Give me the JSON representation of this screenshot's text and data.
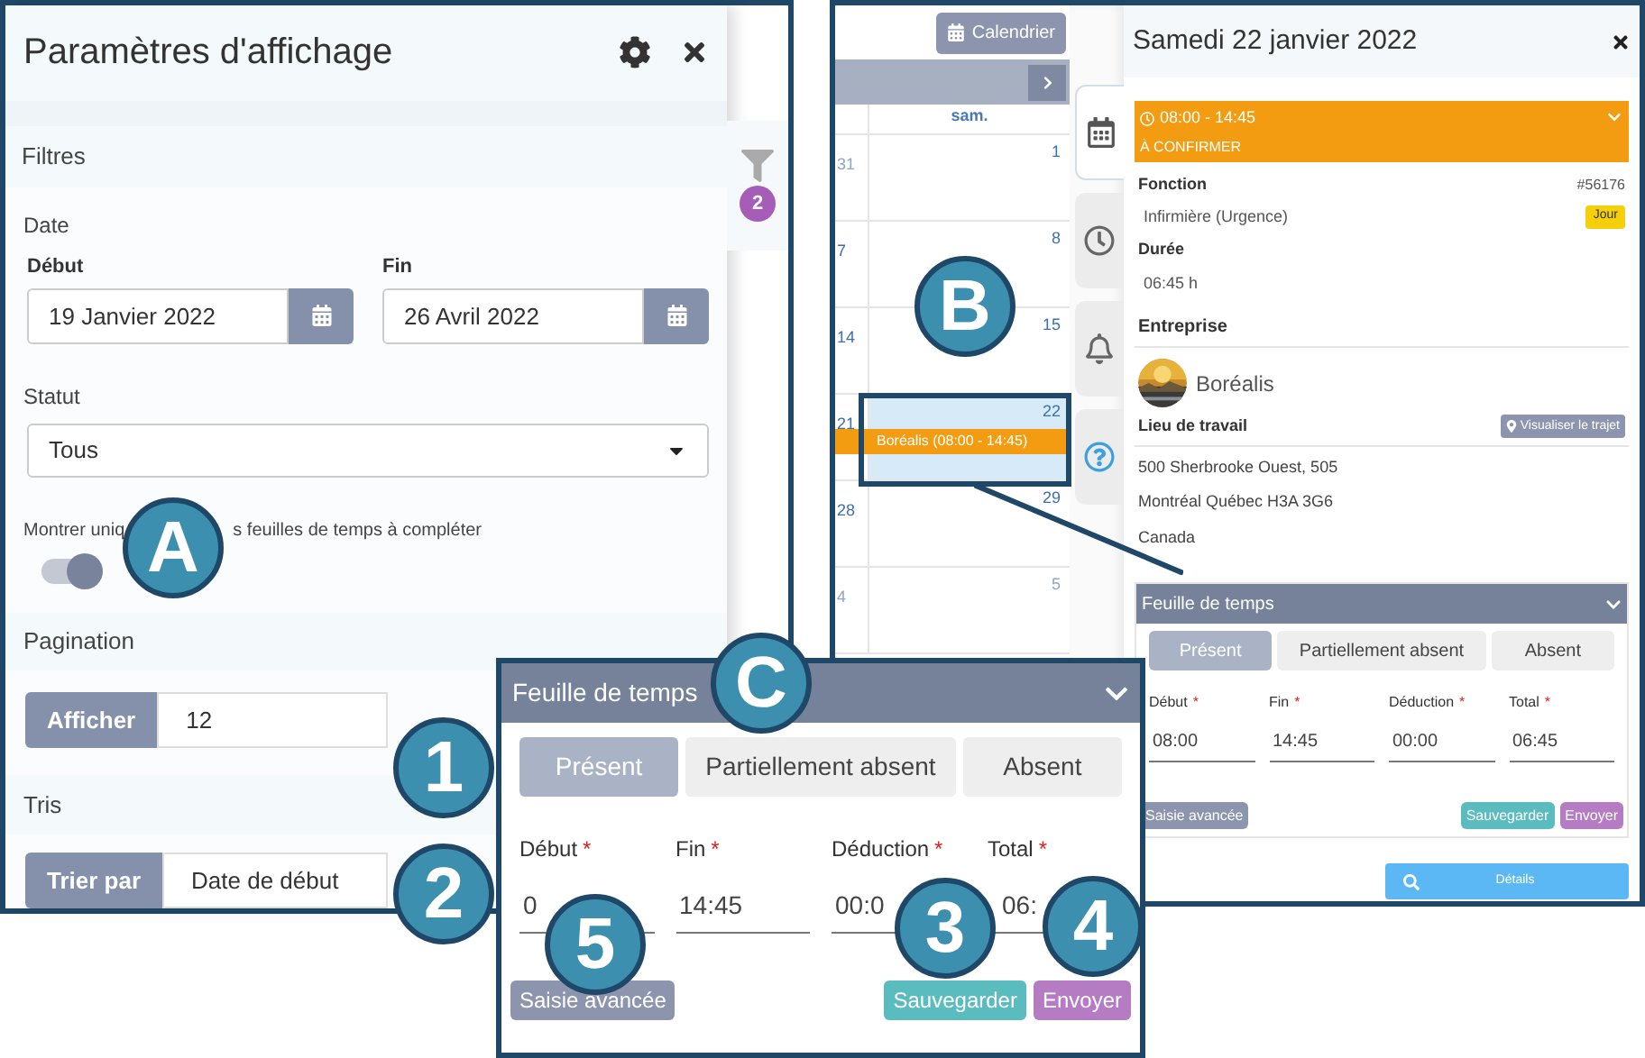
{
  "display_settings": {
    "title": "Paramètres d'affichage",
    "filters_heading": "Filtres",
    "date_label": "Date",
    "start": {
      "label": "Début",
      "value": "19 Janvier 2022"
    },
    "end": {
      "label": "Fin",
      "value": "26 Avril 2022"
    },
    "status": {
      "label": "Statut",
      "value": "Tous"
    },
    "toggle": {
      "label_parts": [
        "Montrer uniq",
        "s feuilles de temps à compléter"
      ],
      "on": true
    },
    "pagination": {
      "heading": "Pagination",
      "addon": "Afficher",
      "value": "12"
    },
    "sort": {
      "heading": "Tris",
      "addon": "Trier par",
      "value": "Date de début"
    },
    "filter_badge": "2"
  },
  "calendar": {
    "toolbar_button": "Calendrier",
    "column_header": "sam.",
    "weeks": [
      {
        "days": [
          {
            "label": "31",
            "muted": true
          },
          {
            "label": "1",
            "muted": false
          }
        ]
      },
      {
        "days": [
          {
            "label": "7",
            "muted": false
          },
          {
            "label": "8",
            "muted": false
          }
        ]
      },
      {
        "days": [
          {
            "label": "14",
            "muted": false
          },
          {
            "label": "15",
            "muted": false
          }
        ]
      },
      {
        "days": [
          {
            "label": "21",
            "muted": false
          },
          {
            "label": "22",
            "muted": false
          }
        ],
        "event": "Boréalis (08:00 - 14:45)"
      },
      {
        "days": [
          {
            "label": "28",
            "muted": false
          },
          {
            "label": "29",
            "muted": false
          }
        ]
      },
      {
        "days": [
          {
            "label": "4",
            "muted": true
          },
          {
            "label": "5",
            "muted": true
          }
        ]
      }
    ]
  },
  "side_tabs": [
    {
      "kind": "calendar",
      "selected": true
    },
    {
      "kind": "clock",
      "selected": false
    },
    {
      "kind": "bell",
      "selected": false
    },
    {
      "kind": "help",
      "selected": false
    }
  ],
  "details": {
    "title": "Samedi 22 janvier 2022",
    "shift": {
      "time": "08:00 - 14:45",
      "status": "À CONFIRMER"
    },
    "function": {
      "label": "Fonction",
      "id": "#56176",
      "value": "Infirmière (Urgence)",
      "badge": "Jour"
    },
    "duration": {
      "label": "Durée",
      "value": "06:45 h"
    },
    "company": {
      "label": "Entreprise",
      "name": "Boréalis"
    },
    "workplace": {
      "label": "Lieu de travail",
      "button": "Visualiser le trajet",
      "address": [
        "500 Sherbrooke Ouest, 505",
        "Montréal Québec H3A 3G6",
        "Canada"
      ]
    },
    "timesheet": {
      "title": "Feuille de temps",
      "tabs": [
        {
          "label": "Présent",
          "selected": true
        },
        {
          "label": "Partiellement absent",
          "selected": false
        },
        {
          "label": "Absent",
          "selected": false
        }
      ],
      "fields": [
        {
          "label": "Début",
          "mark": "*",
          "value": "08:00"
        },
        {
          "label": "Fin",
          "mark": "*",
          "value": "14:45"
        },
        {
          "label": "Déduction",
          "mark": "*",
          "value": "00:00"
        },
        {
          "label": "Total",
          "mark": "*",
          "value": "06:45"
        }
      ],
      "buttons": [
        {
          "kind": "advanced",
          "label": "Saisie avancée"
        },
        {
          "kind": "save",
          "label": "Sauvegarder"
        },
        {
          "kind": "send",
          "label": "Envoyer"
        }
      ]
    },
    "details_button": "Détails"
  },
  "timesheet_zoom": {
    "title": "Feuille de temps",
    "tabs": [
      {
        "label": "Présent",
        "selected": true
      },
      {
        "label": "Partiellement absent",
        "selected": false
      },
      {
        "label": "Absent",
        "selected": false
      }
    ],
    "fields": [
      {
        "label": "Début",
        "mark": "*",
        "value": "0"
      },
      {
        "label": "Fin",
        "mark": "*",
        "value": "14:45"
      },
      {
        "label": "Déduction",
        "mark": "*",
        "value": "00:0"
      },
      {
        "label": "Total",
        "mark": "*",
        "value": "06:"
      }
    ],
    "buttons": [
      {
        "kind": "advanced",
        "label": "Saisie avancée"
      },
      {
        "kind": "save",
        "label": "Sauvegarder"
      },
      {
        "kind": "send",
        "label": "Envoyer"
      }
    ]
  },
  "callouts": [
    {
      "label": "A"
    },
    {
      "label": "B"
    },
    {
      "label": "C"
    },
    {
      "label": "1"
    },
    {
      "label": "2"
    },
    {
      "label": "5"
    },
    {
      "label": "3"
    },
    {
      "label": "4"
    }
  ]
}
